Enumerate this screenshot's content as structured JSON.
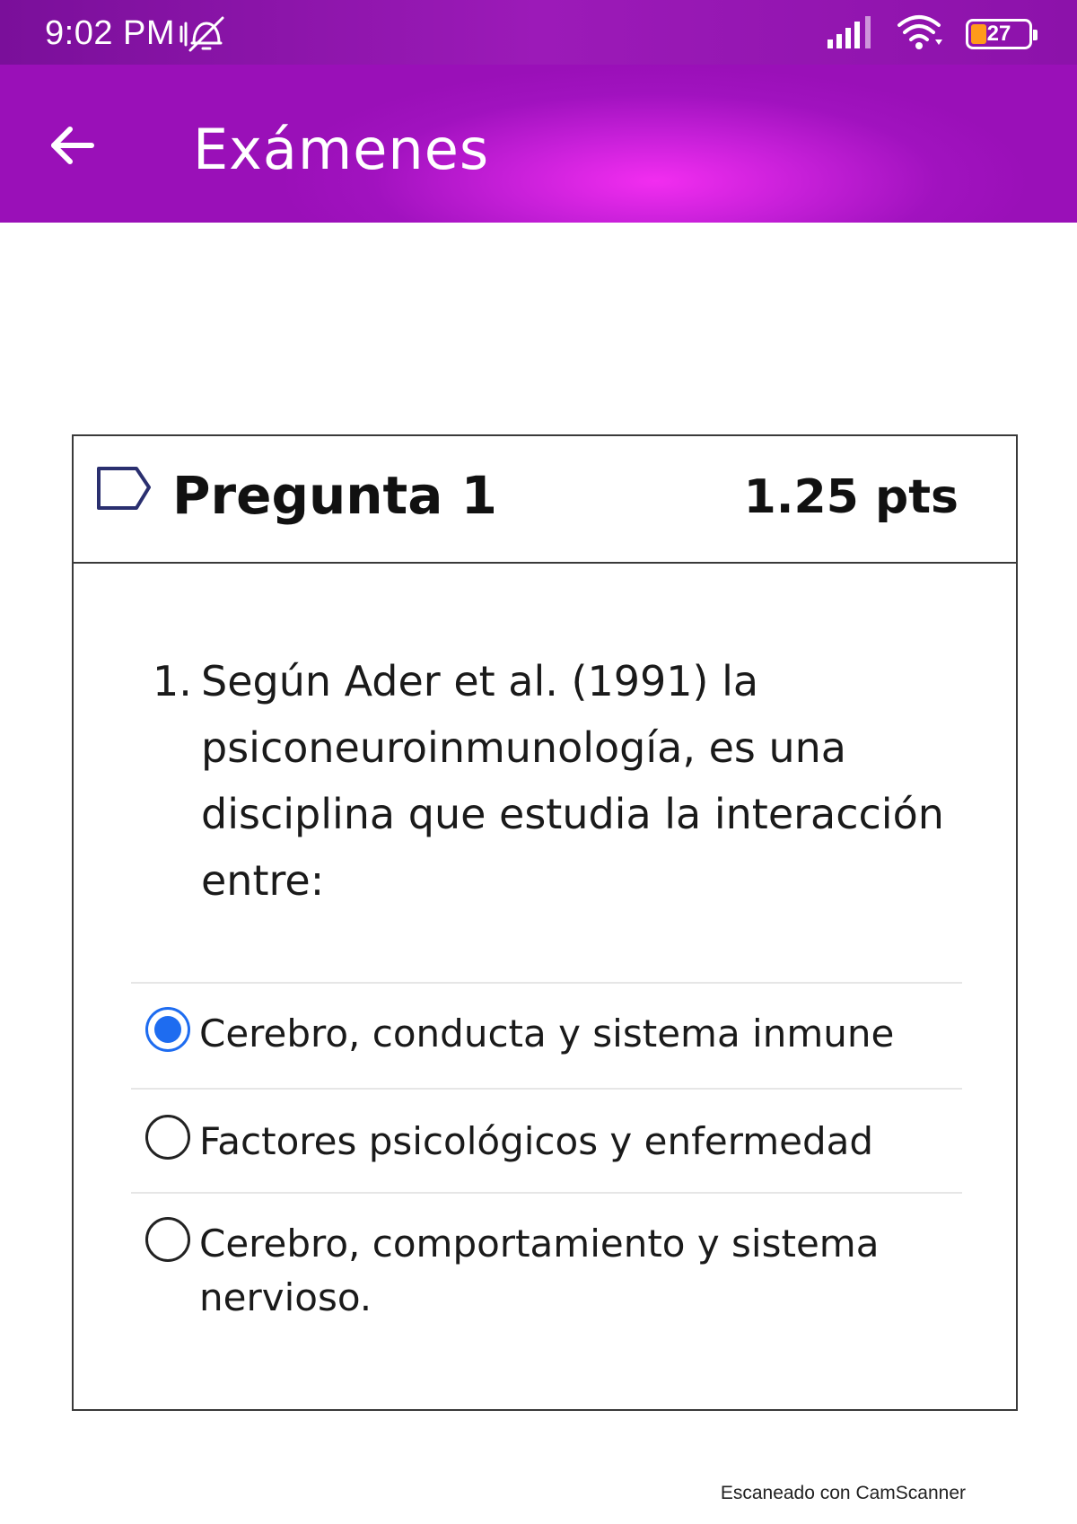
{
  "status_bar": {
    "time": "9:02 PM",
    "battery_level": "27",
    "battery_fraction": 0.27,
    "icons": [
      "vibrate-mute-icon",
      "signal-icon",
      "wifi-icon",
      "battery-icon"
    ]
  },
  "app_bar": {
    "title": "Exámenes",
    "back_icon": "arrow-left-icon",
    "gradient_colors": [
      "#9a10b8",
      "#f22df0"
    ]
  },
  "question": {
    "flag_icon": "flag-icon",
    "title": "Pregunta 1",
    "points": "1.25 pts",
    "number": "1.",
    "text": "Según Ader et al. (1991) la psiconeuroinmunología, es una disciplina que estudia la interacción entre:",
    "answers": [
      {
        "label": "Cerebro, conducta y sistema inmune",
        "selected": true
      },
      {
        "label": "Factores psicológicos y enfermedad",
        "selected": false
      },
      {
        "label": "Cerebro, comportamiento y sistema nervioso.",
        "selected": false
      }
    ],
    "selected_color": "#1e6cf0"
  },
  "watermark": "Escaneado con CamScanner"
}
